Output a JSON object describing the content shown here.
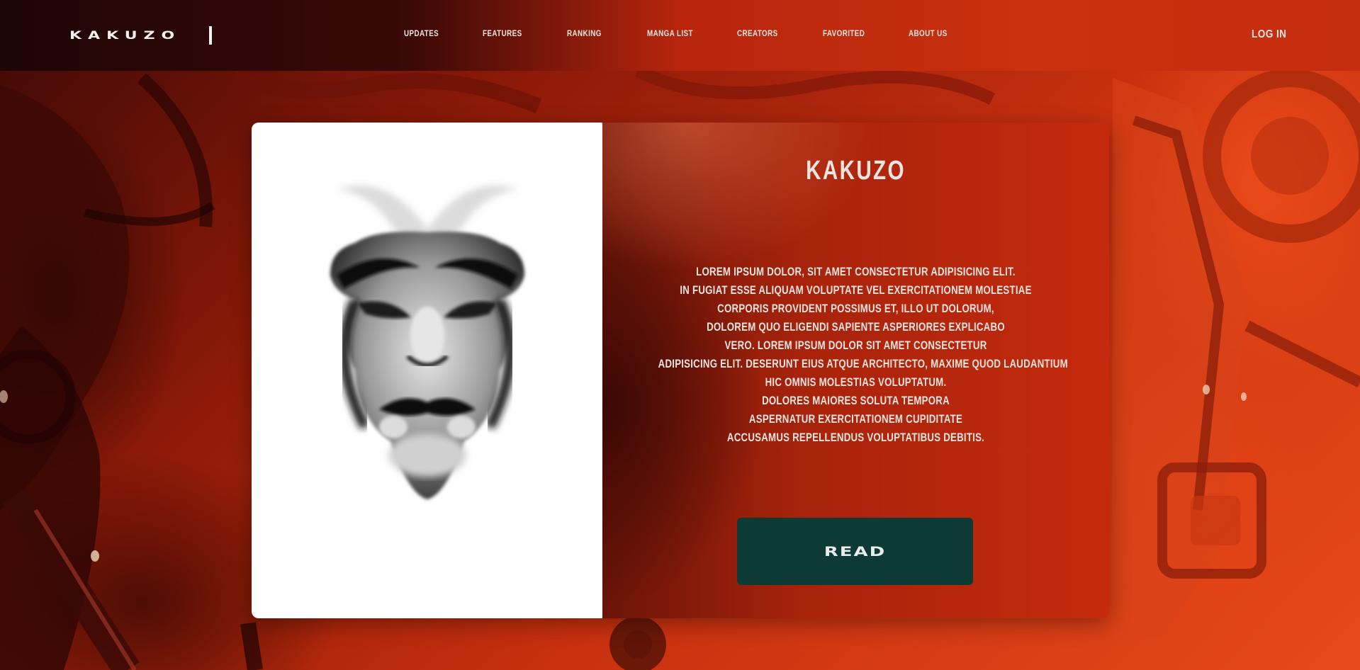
{
  "header": {
    "logo": "KAKUZO",
    "nav": [
      {
        "label": "UPDATES"
      },
      {
        "label": "FEATURES"
      },
      {
        "label": "RANKING"
      },
      {
        "label": "MANGA LIST"
      },
      {
        "label": "CREATORS"
      },
      {
        "label": "FAVORITED"
      },
      {
        "label": "ABOUT US"
      }
    ],
    "login_label": "LOG IN"
  },
  "card": {
    "title": "KAKUZO",
    "description_lines": [
      "LOREM IPSUM DOLOR, SIT AMET CONSECTETUR ADIPISICING ELIT.",
      "IN FUGIAT ESSE ALIQUAM VOLUPTATE VEL EXERCITATIONEM MOLESTIAE",
      "CORPORIS PROVIDENT POSSIMUS ET, ILLO UT DOLORUM,",
      "DOLOREM QUO ELIGENDI SAPIENTE ASPERIORES EXPLICABO",
      "VERO. LOREM IPSUM DOLOR SIT AMET CONSECTETUR",
      "ADIPISICING ELIT. DESERUNT EIUS ATQUE ARCHITECTO, MAXIME QUOD LAUDANTIUM",
      "HIC OMNIS MOLESTIAS VOLUPTATUM.",
      "DOLORES MAIORES SOLUTA TEMPORA",
      "ASPERNATUR EXERCITATIONEM CUPIDITATE",
      "ACCUSAMUS REPELLENDUS VOLUPTATIBUS DEBITIS."
    ],
    "read_label": "READ"
  },
  "colors": {
    "accent_button": "#0e3a35",
    "card_left": "#ffffff",
    "text": "#f1e4df"
  }
}
